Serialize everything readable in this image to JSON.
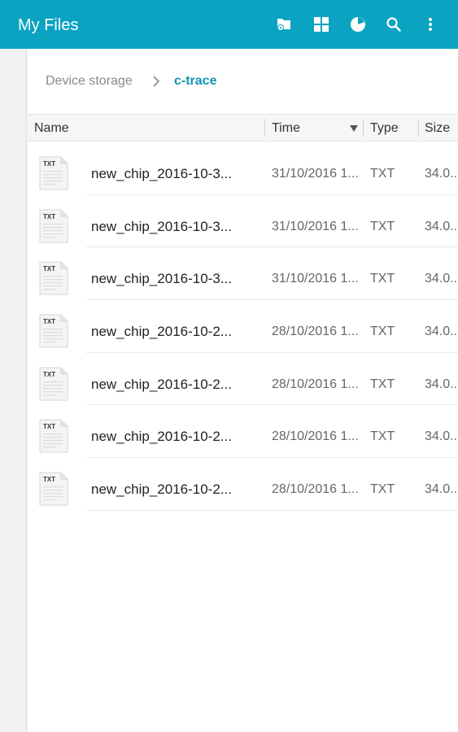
{
  "app": {
    "title": "My Files"
  },
  "toolbar": {
    "icons": [
      "storage-icon",
      "grid-view-icon",
      "pie-chart-icon",
      "search-icon",
      "more-vert-icon"
    ]
  },
  "breadcrumb": {
    "root": "Device storage",
    "current": "c-trace"
  },
  "columns": {
    "name": "Name",
    "time": "Time",
    "type": "Type",
    "size": "Size"
  },
  "files": [
    {
      "name": "new_chip_2016-10-3...",
      "time": "31/10/2016 1...",
      "type": "TXT",
      "size": "34.0...",
      "icon_label": "TXT"
    },
    {
      "name": "new_chip_2016-10-3...",
      "time": "31/10/2016 1...",
      "type": "TXT",
      "size": "34.0...",
      "icon_label": "TXT"
    },
    {
      "name": "new_chip_2016-10-3...",
      "time": "31/10/2016 1...",
      "type": "TXT",
      "size": "34.0...",
      "icon_label": "TXT"
    },
    {
      "name": "new_chip_2016-10-2...",
      "time": "28/10/2016 1...",
      "type": "TXT",
      "size": "34.0...",
      "icon_label": "TXT"
    },
    {
      "name": "new_chip_2016-10-2...",
      "time": "28/10/2016 1...",
      "type": "TXT",
      "size": "34.0...",
      "icon_label": "TXT"
    },
    {
      "name": "new_chip_2016-10-2...",
      "time": "28/10/2016 1...",
      "type": "TXT",
      "size": "34.0...",
      "icon_label": "TXT"
    },
    {
      "name": "new_chip_2016-10-2...",
      "time": "28/10/2016 1...",
      "type": "TXT",
      "size": "34.0...",
      "icon_label": "TXT"
    }
  ],
  "colors": {
    "appbar": "#0aa3c2",
    "breadcrumb_current": "#1196b4"
  }
}
